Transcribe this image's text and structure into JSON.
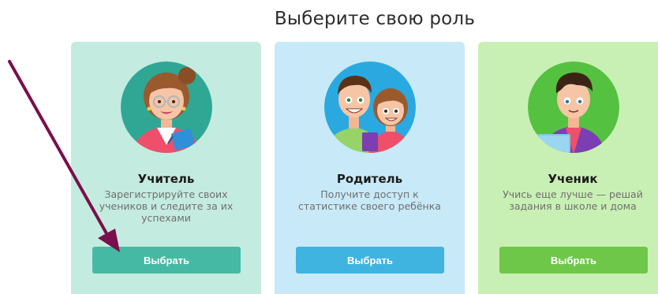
{
  "page": {
    "title": "Выберите свою роль"
  },
  "roles": [
    {
      "id": "teacher",
      "title": "Учитель",
      "description": "Зарегистрируйте своих учеников и следите за их успехами",
      "button_label": "Выбрать",
      "card_color": "#c4ebdf",
      "avatar_bg": "#30a795",
      "button_color": "#45b9a3",
      "icon": "teacher-avatar"
    },
    {
      "id": "parent",
      "title": "Родитель",
      "description": "Получите доступ к статистике своего ребёнка",
      "button_label": "Выбрать",
      "card_color": "#c8e9f8",
      "avatar_bg": "#2aa9e0",
      "button_color": "#3fb4e0",
      "icon": "parents-avatar"
    },
    {
      "id": "student",
      "title": "Ученик",
      "description": "Учись еще лучше — решай задания в школе и дома",
      "button_label": "Выбрать",
      "card_color": "#c9f0b4",
      "avatar_bg": "#55c140",
      "button_color": "#6fc74a",
      "icon": "student-avatar"
    }
  ],
  "annotation": {
    "arrow_color": "#7a0f4b",
    "icon": "arrow-pointer"
  }
}
